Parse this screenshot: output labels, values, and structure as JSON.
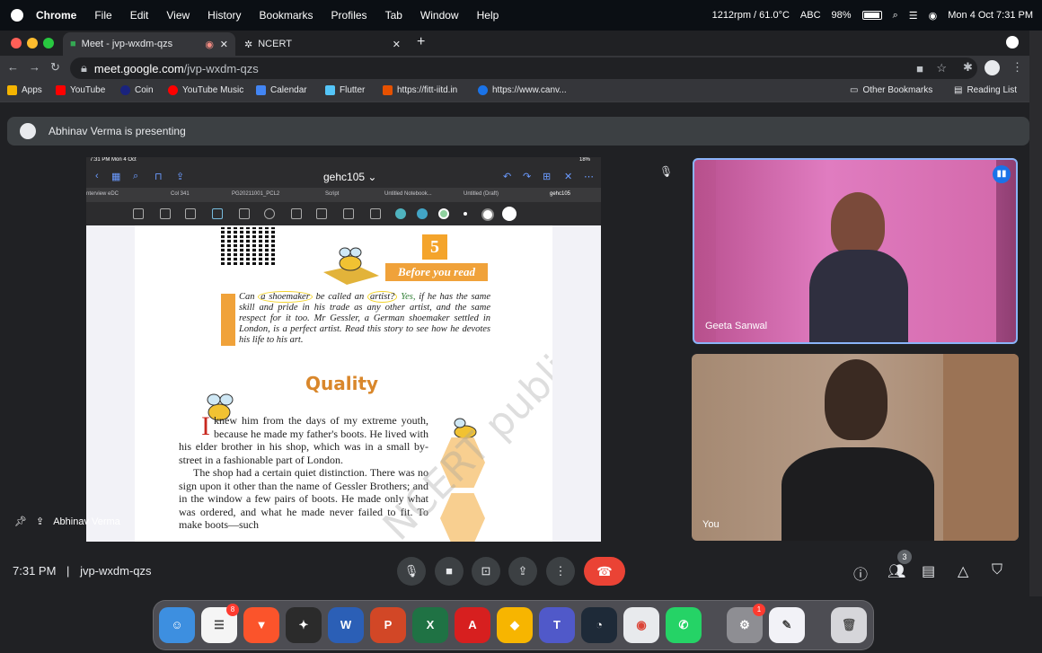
{
  "menubar": {
    "app": "Chrome",
    "menus": [
      "File",
      "Edit",
      "View",
      "History",
      "Bookmarks",
      "Profiles",
      "Tab",
      "Window",
      "Help"
    ],
    "status": "1212rpm / 61.0°C",
    "input": "ABC",
    "battery": "98%",
    "datetime": "Mon 4 Oct  7:31 PM"
  },
  "tabs": [
    {
      "label": "Meet - jvp-wxdm-qzs",
      "active": true
    },
    {
      "label": "NCERT",
      "active": false
    }
  ],
  "address": {
    "host": "meet.google.com",
    "path": "/jvp-wxdm-qzs"
  },
  "bookmarks": {
    "items": [
      "Apps",
      "YouTube",
      "Coin",
      "YouTube Music",
      "Calendar",
      "Flutter",
      "https://fitt-iitd.in",
      "https://www.canv..."
    ],
    "other": "Other Bookmarks",
    "reading": "Reading List"
  },
  "presenting": "Abhinav Verma is presenting",
  "shared": {
    "status_time": "7:31 PM  Mon 4 Oct",
    "status_right": "18%",
    "doc_title": "gehc105 ⌄",
    "doc_tabs": [
      "nterview eDC",
      "Col 341",
      "PG20211001_PCL2",
      "Script",
      "Untitled Notebook...",
      "Untitled (Draft)",
      "gehc105"
    ],
    "page": {
      "chapter": "5",
      "before_you_read": "Before you read",
      "intro_q1": "Can",
      "intro_shoemaker": "a shoemaker",
      "intro_q2": "be called an",
      "intro_artist": "artist?",
      "intro_yes": "Yes,",
      "intro_rest": "if he has the same skill and pride in his trade as any other artist, and the same respect for it too. Mr Gessler, a German shoemaker settled in London, is a perfect artist. Read this story to see how he devotes his life to his art.",
      "title": "Quality",
      "dropcap": "I",
      "para1": "knew him from the days of my extreme youth, because he made my father's boots. He lived with his elder brother in his shop, which was in a small by-street in a fashionable part of London.",
      "para2": "The shop had a certain quiet distinction. There was no sign upon it other than the name of Gessler Brothers; and in the window a few pairs of boots. He made only what was ordered, and what he made never failed to fit. To make boots—such",
      "watermark": "NCERT published"
    },
    "sharer": "Abhinav Verma"
  },
  "tiles": [
    {
      "name": "Geeta Sanwal"
    },
    {
      "name": "You"
    }
  ],
  "meetbar": {
    "time": "7:31 PM",
    "code": "jvp-wxdm-qzs",
    "participants": "3"
  },
  "dock": {
    "reminders_badge": "8",
    "settings_badge": "1"
  }
}
